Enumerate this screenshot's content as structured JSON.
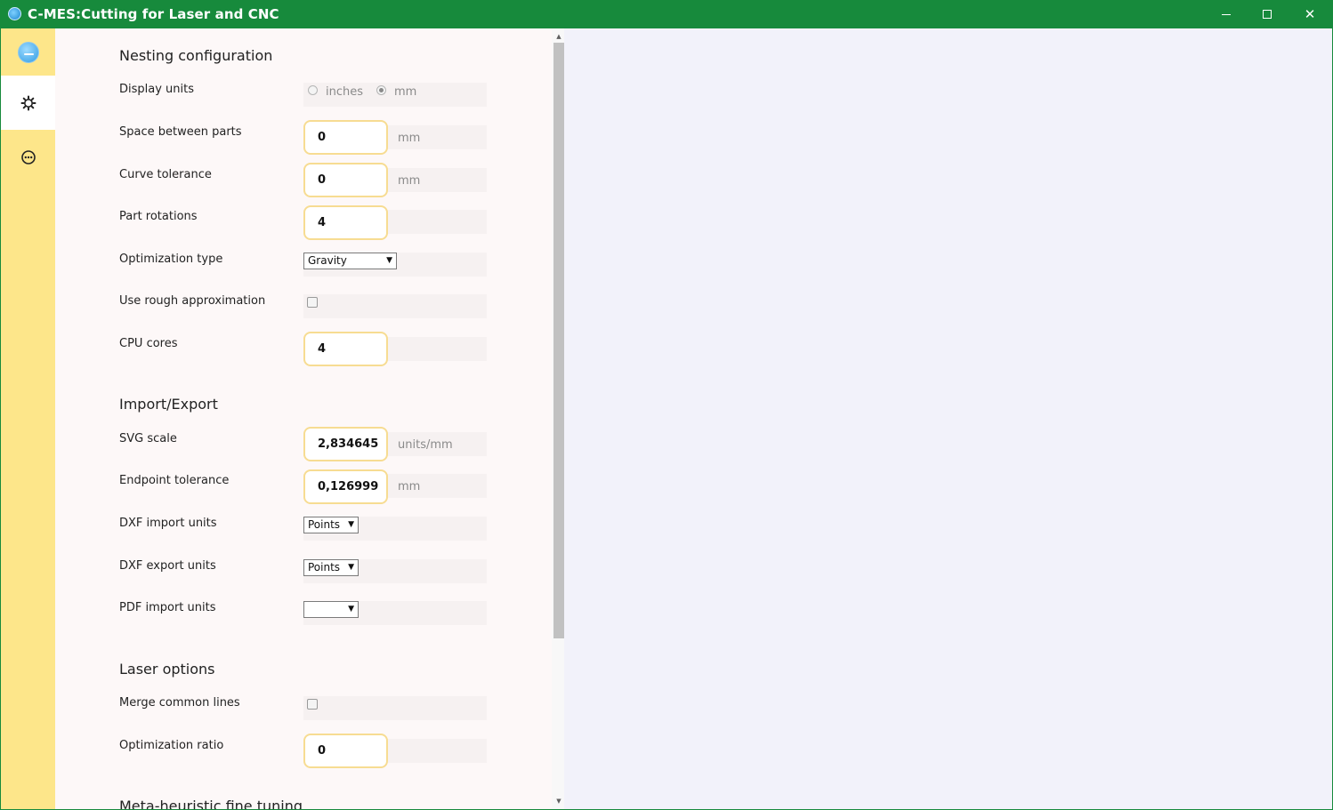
{
  "window": {
    "title": "C-MES:Cutting for Laser and CNC",
    "minimize_glyph": "",
    "maximize_glyph": "",
    "close_glyph": "✕"
  },
  "sidebar": {
    "items": [
      {
        "icon": "app-logo-icon"
      },
      {
        "icon": "gear-icon",
        "active": true
      },
      {
        "icon": "info-icon"
      }
    ]
  },
  "sections": {
    "nesting": "Nesting configuration",
    "import_export": "Import/Export",
    "laser": "Laser options",
    "metaheuristic": "Meta-heuristic fine tuning"
  },
  "fields": {
    "display_units": {
      "label": "Display units",
      "options": [
        "inches",
        "mm"
      ],
      "selected": "mm"
    },
    "space_between_parts": {
      "label": "Space between parts",
      "value": "0",
      "unit": "mm"
    },
    "curve_tolerance": {
      "label": "Curve tolerance",
      "value": "0",
      "unit": "mm"
    },
    "part_rotations": {
      "label": "Part rotations",
      "value": "4"
    },
    "optimization_type": {
      "label": "Optimization type",
      "value": "Gravity"
    },
    "rough_approx": {
      "label": "Use rough approximation",
      "checked": false
    },
    "cpu_cores": {
      "label": "CPU cores",
      "value": "4"
    },
    "svg_scale": {
      "label": "SVG scale",
      "value": "2,834645",
      "unit": "units/mm"
    },
    "endpoint_tolerance": {
      "label": "Endpoint tolerance",
      "value": "0,126999",
      "unit": "mm"
    },
    "dxf_import_units": {
      "label": "DXF import units",
      "value": "Points"
    },
    "dxf_export_units": {
      "label": "DXF export units",
      "value": "Points"
    },
    "pdf_import_units": {
      "label": "PDF import units",
      "value": ""
    },
    "merge_common_lines": {
      "label": "Merge common lines",
      "checked": false
    },
    "optimization_ratio": {
      "label": "Optimization ratio",
      "value": "0"
    }
  },
  "colors": {
    "titlebar": "#178a3c",
    "sidebar": "#fde68a",
    "input_border": "#f7dc92",
    "panel": "#fdf8f8",
    "workspace": "#f2f2fa"
  }
}
